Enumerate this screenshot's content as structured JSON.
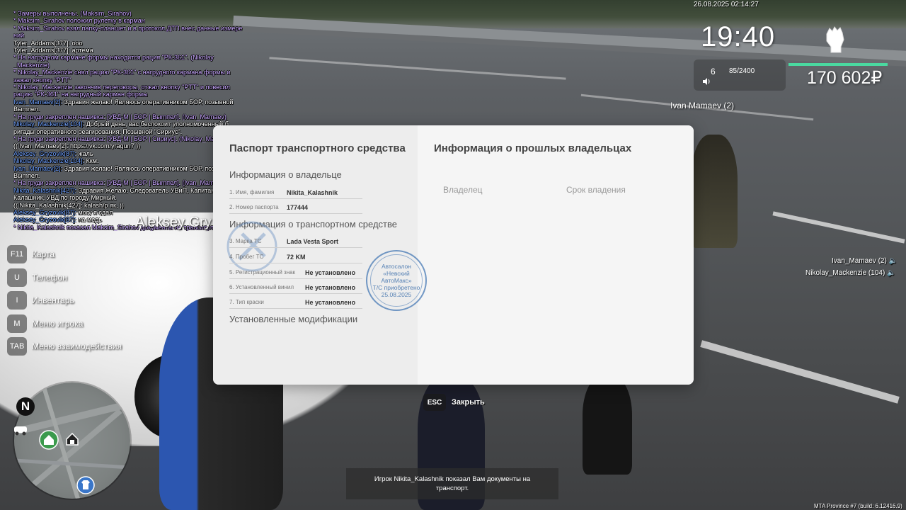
{
  "chat": [
    {
      "type": "me",
      "text": "* Замеры выполнены. (Maksim_Sirahov)"
    },
    {
      "type": "me",
      "text": "* Maksim_Sirahov положил рулетку в карман"
    },
    {
      "type": "me",
      "text": "* Maksim_Sirahov взял папку-планшет и в протокол ДТП внес данные измере"
    },
    {
      "type": "me",
      "text": "ний"
    },
    {
      "type": "white",
      "text": "Tyler_Addams[377]: ооо"
    },
    {
      "type": "white",
      "text": "Tyler_Addams[377]: артема"
    },
    {
      "type": "me",
      "text": "* На нагрудном кармане формы находится рация \"РК-361\". (Nikolay"
    },
    {
      "type": "me",
      "text": "_Mackenzie)"
    },
    {
      "type": "me",
      "text": "* Nikolay_Mackenzie снял рацию \"РК-361\" с нагрудного кармана формы и"
    },
    {
      "type": "me",
      "text": "зажал кнопку \"PTT\""
    },
    {
      "type": "me",
      "text": "* Nikolay_Mackenzie закончив переговоры, отжал кнопку \"PTT\" и повесил"
    },
    {
      "type": "me",
      "text": "рацию \"РК-361\" на нагрудный карман формы"
    },
    {
      "type": "name",
      "name": "Ivan_Mamaev[2]:",
      "text": " Здравия желаю! Являюсь оперативником БОР, позывной"
    },
    {
      "type": "white",
      "text": " Выmпел."
    },
    {
      "type": "me",
      "text": "* На груди закреплен нашивка: [УВД-М | БОР | Выmпел]. (Ivan_Mamaev)"
    },
    {
      "type": "name",
      "name": "Nikolay_Mackenzie[104]:",
      "text": " Добрый день, вас беспокоит уполномоченный б"
    },
    {
      "type": "white",
      "text": "ригады оперативного реагирования! Позывной \"Сириус\"."
    },
    {
      "type": "me",
      "text": "* На груди закреплен нашивка: [УВД-М | БОР | Сириус]. (Nikolay_Mackenzie)"
    },
    {
      "type": "white",
      "text": "(( Ivan_Mamaev[2]: https://vk.com/yragun7 ))"
    },
    {
      "type": "name",
      "name": "Aleksey_Gryzovik[87]:",
      "text": " жаль"
    },
    {
      "type": "name",
      "name": "Nikolay_Mackenzie[104]:",
      "text": " Ккм."
    },
    {
      "type": "name",
      "name": "Ivan_Mamaev[2]:",
      "text": " Здравия желаю! Являюсь оперативником БОР, позывной"
    },
    {
      "type": "white",
      "text": " Выmпел."
    },
    {
      "type": "me",
      "text": "* На груди закреплен нашивка: [УВД-М | БОР | Выmпел]. (Ivan_Mamaev)"
    },
    {
      "type": "name",
      "name": "Nikita_Kalashnik[427]:",
      "text": " Здравия Желаю, Следователь УВиП, Капитан юстиции,"
    },
    {
      "type": "white",
      "text": " Калашник, УВД по городу Мирный."
    },
    {
      "type": "white",
      "text": "(( Nikita_Kalashnik[427]: kalash/p як, ))"
    },
    {
      "type": "name",
      "name": "Aleksey_Gryzovik[87]:",
      "text": " могу я сдал"
    },
    {
      "type": "name",
      "name": "Aleksey_Gryzovik[87]:",
      "text": " на медь"
    },
    {
      "type": "me",
      "text": "* Nikita_Kalashnik показал Maksim_Sirahov документы на транспорт"
    }
  ],
  "nameplates": {
    "aleksey": "Aleksey Gry",
    "ivan": "Ivan Mamaev (2)"
  },
  "hud": {
    "date": "26.08.2025 02:14:27",
    "time": "19:40",
    "ammo_clip": "6",
    "ammo_total": "85/2400",
    "money": "170 602₽",
    "health_color": "#4ad9a0"
  },
  "voice": [
    {
      "name": "Ivan_Mamaev (2)"
    },
    {
      "name": "Nikolay_Mackenzie (104)"
    }
  ],
  "menu": [
    {
      "key": "F11",
      "label": "Карта"
    },
    {
      "key": "U",
      "label": "Телефон"
    },
    {
      "key": "I",
      "label": "Инвентарь"
    },
    {
      "key": "M",
      "label": "Меню игрока"
    },
    {
      "key": "TAB",
      "label": "Меню взаимодействия"
    }
  ],
  "minimap": {
    "north": "N"
  },
  "dialog": {
    "left_title": "Паспорт транспортного средства",
    "owner_section": "Информация о владельце",
    "owner_fields": [
      {
        "label": "1. Имя, фамилия",
        "value": "Nikita_Kalashnik"
      },
      {
        "label": "2. Номер паспорта",
        "value": "177444"
      }
    ],
    "vehicle_section": "Информация о транспортном средстве",
    "vehicle_fields": [
      {
        "label": "3. Марка ТС",
        "value": "Lada Vesta Sport"
      },
      {
        "label": "4. Пробег ТС",
        "value": "72 KM"
      },
      {
        "label": "5. Регистрационный знак",
        "value": "Не установлено"
      },
      {
        "label": "6. Установленный винил",
        "value": "Не установлено"
      },
      {
        "label": "7. Тип краски",
        "value": "Не установлено"
      }
    ],
    "mods_section": "Установленные модификации",
    "right_title": "Информация о прошлых владельцах",
    "col_owner": "Владелец",
    "col_period": "Срок владения",
    "stamp_line1": "Автосалон",
    "stamp_line2": "«Невский АвтоМакс»",
    "stamp_line3": "Т/С приобретено",
    "stamp_line4": "25.08.2025"
  },
  "close": {
    "key": "ESC",
    "label": "Закрыть"
  },
  "notification": "Игрок Nikita_Kalashnik показал Вам документы на транспорт.",
  "build": "MTA Province #7 (build: 6.12416.9)"
}
